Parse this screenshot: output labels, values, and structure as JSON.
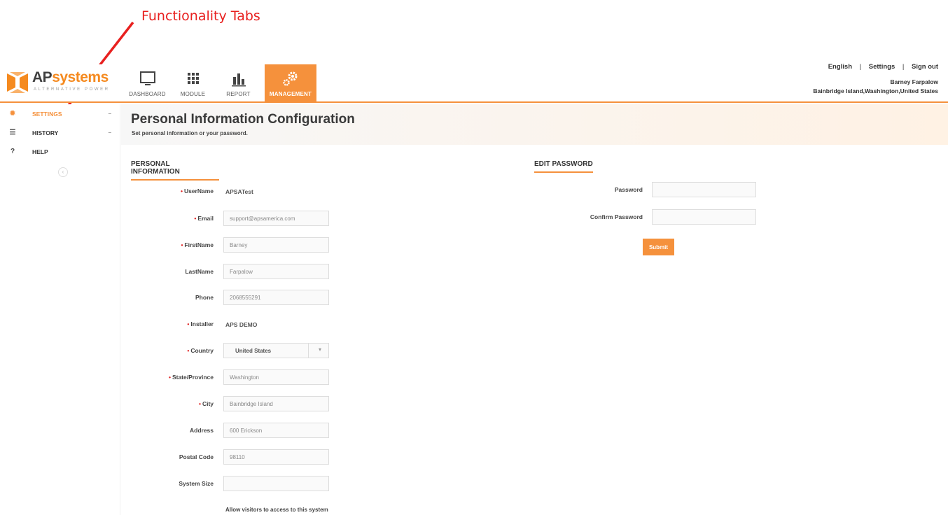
{
  "annotation": {
    "label": "Functionality Tabs"
  },
  "brand": {
    "name_dark": "AP",
    "name_orange": "systems",
    "tagline": "ALTERNATIVE POWER",
    "accent_color": "#f5913c"
  },
  "nav": {
    "tabs": [
      {
        "label": "DASHBOARD",
        "icon": "monitor-icon"
      },
      {
        "label": "MODULE",
        "icon": "grid-icon"
      },
      {
        "label": "REPORT",
        "icon": "bar-chart-icon"
      },
      {
        "label": "MANAGEMENT",
        "icon": "gears-icon",
        "active": true
      }
    ]
  },
  "top_right": {
    "language": "English",
    "settings": "Settings",
    "signout": "Sign out",
    "separator": "|",
    "user_name": "Barney Farpalow",
    "user_location": "Bainbridge Island,Washington,United States"
  },
  "sidebar": {
    "items": [
      {
        "label": "SETTINGS",
        "icon": "gear-icon",
        "caret": "−",
        "active": true
      },
      {
        "label": "HISTORY",
        "icon": "database-icon",
        "caret": "−"
      },
      {
        "label": "HELP",
        "icon": "question-icon"
      }
    ],
    "collapse_glyph": "‹"
  },
  "page": {
    "title": "Personal Information Configuration",
    "subtitle": "Set personal information or your password."
  },
  "personal": {
    "heading": "PERSONAL INFORMATION",
    "required_mark": "•",
    "username_label": "UserName",
    "username_value": "APSATest",
    "email_label": "Email",
    "email_value": "support@apsamerica.com",
    "firstname_label": "FirstName",
    "firstname_value": "Barney",
    "lastname_label": "LastName",
    "lastname_value": "Farpalow",
    "phone_label": "Phone",
    "phone_value": "2068555291",
    "installer_label": "Installer",
    "installer_value": "APS DEMO",
    "country_label": "Country",
    "country_value": "United States",
    "country_caret": "▾",
    "state_label": "State/Province",
    "state_value": "Washington",
    "city_label": "City",
    "city_value": "Bainbridge Island",
    "address_label": "Address",
    "address_value": "600 Erickson",
    "postal_label": "Postal Code",
    "postal_value": "98110",
    "system_size_label": "System Size",
    "system_size_value": "",
    "allow_visitors": "Allow visitors to access to this system"
  },
  "password": {
    "heading": "EDIT PASSWORD",
    "password_label": "Password",
    "password_value": "",
    "confirm_label": "Confirm Password",
    "confirm_value": "",
    "submit_label": "Submit"
  }
}
